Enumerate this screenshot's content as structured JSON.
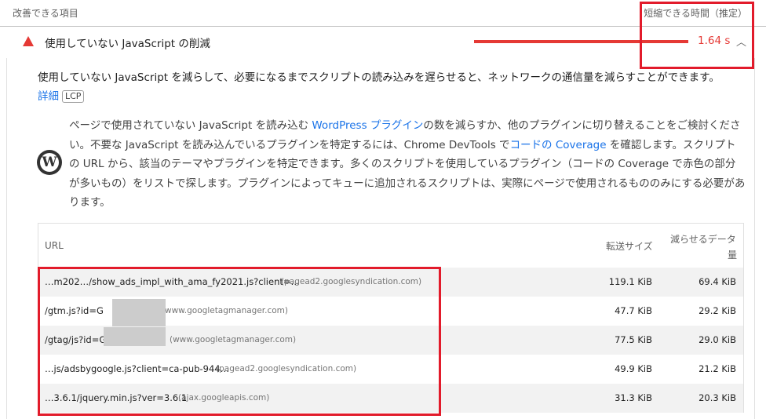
{
  "header": {
    "left_label": "改善できる項目",
    "right_label": "短縮できる時間（推定）"
  },
  "audit": {
    "title": "使用していない JavaScript の削減",
    "value": "1.64 s",
    "status_color": "#e53935",
    "chevron": "chevron-up-icon"
  },
  "description": {
    "text": "使用していない JavaScript を減らして、必要になるまでスクリプトの読み込みを遅らせると、ネットワークの通信量を減らすことができます。",
    "learn_more": "詳細",
    "badge": "LCP"
  },
  "wordpress": {
    "icon": "wordpress-icon",
    "seg1": "ページで使用されていない JavaScript を読み込む ",
    "link1": "WordPress プラグイン",
    "seg2": "の数を減らすか、他のプラグインに切り替えることをご検討ください。不要な JavaScript を読み込んでいるプラグインを特定するには、Chrome DevTools で",
    "link2": "コードの Coverage",
    "seg3": " を確認します。スクリプトの URL から、該当のテーマやプラグインを特定できます。多くのスクリプトを使用しているプラグイン（コードの Coverage で赤色の部分が多いもの）をリストで探します。プラグインによってキューに追加されるスクリプトは、実際にページで使用されるもののみにする必要があります。"
  },
  "table": {
    "col_url": "URL",
    "col_transfer": "転送サイズ",
    "col_savings_1": "減らせるデータ",
    "col_savings_2": "量",
    "rows": [
      {
        "url": "…m202…/show_ads_impl_with_ama_fy2021.js?client=…",
        "domain": "(pagead2.googlesyndication.com)",
        "transfer": "119.1 KiB",
        "savings": "69.4 KiB"
      },
      {
        "url": "/gtm.js?id=G",
        "domain": "www.googletagmanager.com)",
        "transfer": "47.7 KiB",
        "savings": "29.2 KiB"
      },
      {
        "url": "/gtag/js?id=G",
        "domain": "(www.googletagmanager.com)",
        "transfer": "77.5 KiB",
        "savings": "29.0 KiB"
      },
      {
        "url": "…js/adsbygoogle.js?client=ca-pub-944…",
        "domain": "(pagead2.googlesyndication.com)",
        "transfer": "49.9 KiB",
        "savings": "21.2 KiB"
      },
      {
        "url": "…3.6.1/jquery.min.js?ver=3.6.1",
        "domain": "(ajax.googleapis.com)",
        "transfer": "31.3 KiB",
        "savings": "20.3 KiB"
      }
    ]
  },
  "colors": {
    "highlight": "#e21b2b",
    "link": "#1a73e8",
    "row_shade": "#f2f2f2"
  }
}
